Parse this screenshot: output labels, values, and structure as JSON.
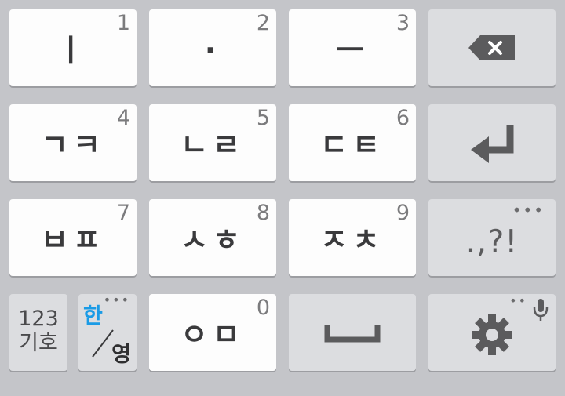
{
  "keys": {
    "k1": {
      "main": "ㅣ",
      "num": "1"
    },
    "k2": {
      "main": "·",
      "num": "2"
    },
    "k3": {
      "main": "ㅡ",
      "num": "3"
    },
    "k4": {
      "main": "ㄱㅋ",
      "num": "4"
    },
    "k5": {
      "main": "ㄴㄹ",
      "num": "5"
    },
    "k6": {
      "main": "ㄷㅌ",
      "num": "6"
    },
    "k7": {
      "main": "ㅂㅍ",
      "num": "7"
    },
    "k8": {
      "main": "ㅅㅎ",
      "num": "8"
    },
    "k9": {
      "main": "ㅈㅊ",
      "num": "9"
    },
    "k0": {
      "main": "ㅇㅁ",
      "num": "0"
    },
    "punct": {
      "label": ".,?!",
      "more": "•••"
    },
    "symbols": {
      "line1": "123",
      "line2": "기호"
    },
    "lang": {
      "primary": "한",
      "secondary": "영",
      "more": "•••"
    },
    "settings": {
      "more": "••"
    }
  },
  "colors": {
    "background": "#c4c5c9",
    "key": "#fdfdfd",
    "function_key": "#dcdde0",
    "accent": "#1a9be6",
    "icon": "#5b5b5d"
  },
  "icons": {
    "backspace": "backspace-icon",
    "enter": "enter-icon",
    "space": "space-icon",
    "settings": "gear-icon",
    "mic": "microphone-icon"
  }
}
